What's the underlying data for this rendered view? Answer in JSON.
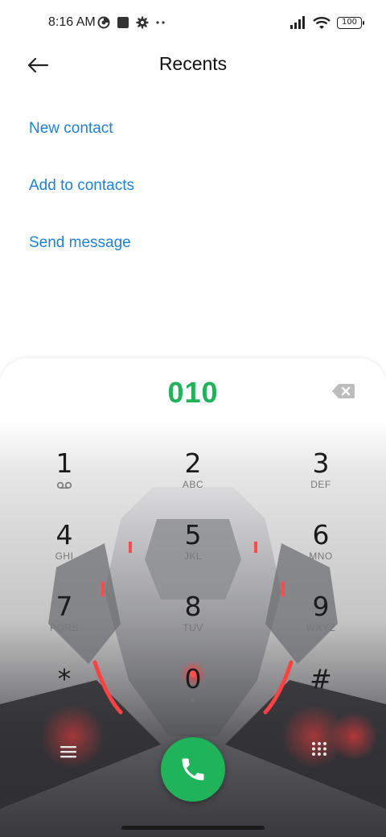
{
  "status_bar": {
    "time": "8:16 AM",
    "battery": "100",
    "icons": [
      "data-saver-icon",
      "app-notification-icon",
      "settings-gear-icon",
      "more-dots-icon",
      "signal-icon",
      "wifi-icon",
      "battery-icon"
    ]
  },
  "header": {
    "title": "Recents",
    "back_icon": "back-arrow-icon"
  },
  "actions": {
    "new_contact": "New contact",
    "add_to_contacts": "Add to contacts",
    "send_message": "Send message"
  },
  "dialer": {
    "number": "010",
    "backspace_icon": "backspace-icon",
    "keys": [
      {
        "digit": "1",
        "sub": ""
      },
      {
        "digit": "2",
        "sub": "ABC"
      },
      {
        "digit": "3",
        "sub": "DEF"
      },
      {
        "digit": "4",
        "sub": "GHI"
      },
      {
        "digit": "5",
        "sub": "JKL"
      },
      {
        "digit": "6",
        "sub": "MNO"
      },
      {
        "digit": "7",
        "sub": "PQRS"
      },
      {
        "digit": "8",
        "sub": "TUV"
      },
      {
        "digit": "9",
        "sub": "WXYZ"
      },
      {
        "digit": "*",
        "sub": ""
      },
      {
        "digit": "0",
        "sub": "+"
      },
      {
        "digit": "#",
        "sub": ""
      }
    ],
    "call_icon": "phone-icon",
    "left_icon": "menu-icon",
    "right_icon": "dialpad-icon"
  },
  "colors": {
    "accent": "#1a82e3",
    "call_green": "#1fb35a"
  }
}
